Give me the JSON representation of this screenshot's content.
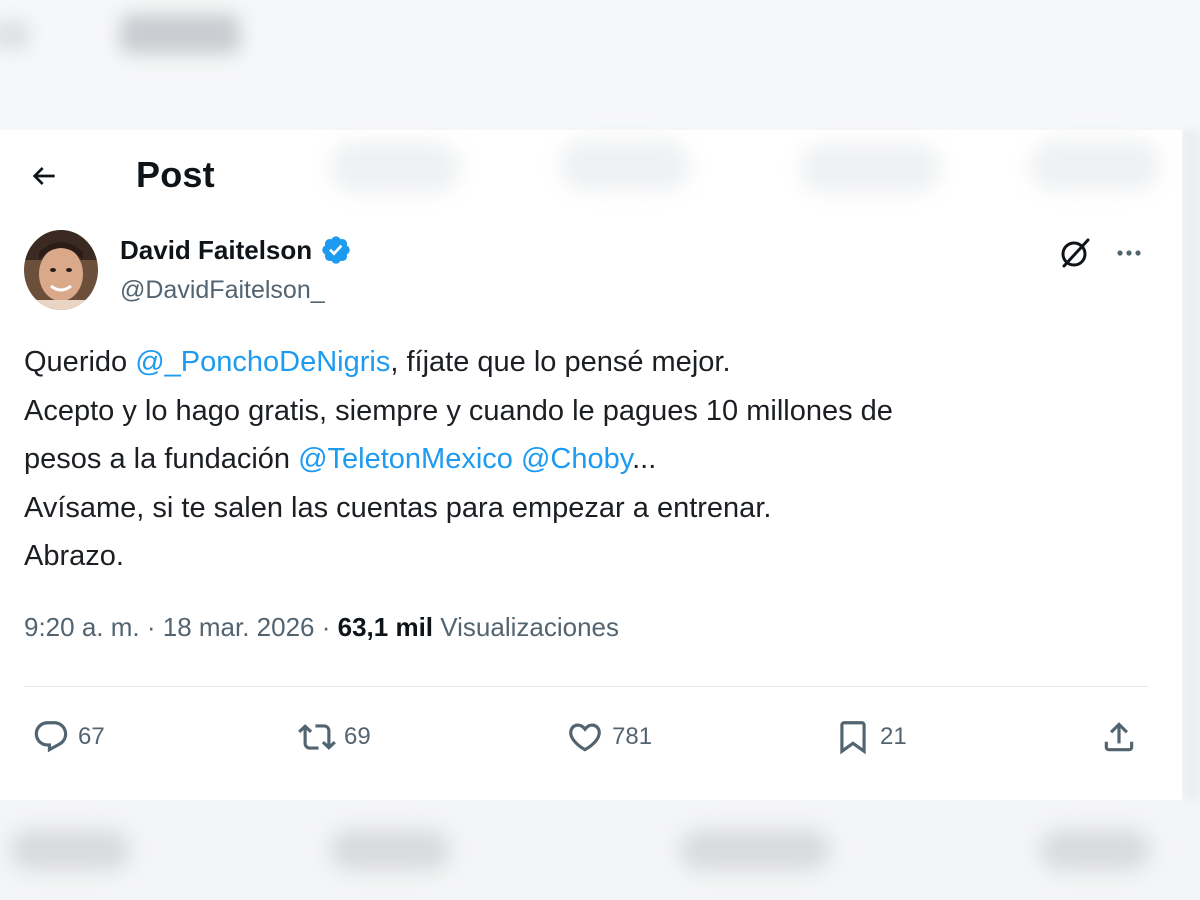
{
  "header": {
    "title": "Post"
  },
  "author": {
    "name": "David Faitelson",
    "handle": "@DavidFaitelson_",
    "verified": true
  },
  "tweet": {
    "lines": [
      [
        {
          "text": "Querido ",
          "type": "text"
        },
        {
          "text": "@_PonchoDeNigris",
          "type": "mention"
        },
        {
          "text": ", fíjate que lo pensé mejor.",
          "type": "text"
        }
      ],
      [
        {
          "text": "Acepto y lo hago gratis, siempre y cuando le pagues 10 millones de",
          "type": "text"
        }
      ],
      [
        {
          "text": "pesos a la fundación ",
          "type": "text"
        },
        {
          "text": "@TeletonMexico",
          "type": "mention"
        },
        {
          "text": " ",
          "type": "text"
        },
        {
          "text": "@Choby",
          "type": "mention"
        },
        {
          "text": "...",
          "type": "text"
        }
      ],
      [
        {
          "text": "Avísame, si te salen las cuentas para empezar a entrenar.",
          "type": "text"
        }
      ],
      [
        {
          "text": "Abrazo.",
          "type": "text"
        }
      ]
    ]
  },
  "meta": {
    "time": "9:20 a. m.",
    "separator": " · ",
    "date": "18 mar. 2026",
    "views_count": "63,1 mil",
    "views_label": "Visualizaciones"
  },
  "actions": {
    "replies": "67",
    "reposts": "69",
    "likes": "781",
    "bookmarks": "21"
  },
  "colors": {
    "accent": "#1d9bf0",
    "text": "#0f1419",
    "secondary": "#536471",
    "verified": "#1d9bf0"
  },
  "icons": [
    "back-arrow-icon",
    "verified-icon",
    "grok-icon",
    "more-icon",
    "reply-icon",
    "repost-icon",
    "like-icon",
    "bookmark-icon",
    "share-icon"
  ]
}
